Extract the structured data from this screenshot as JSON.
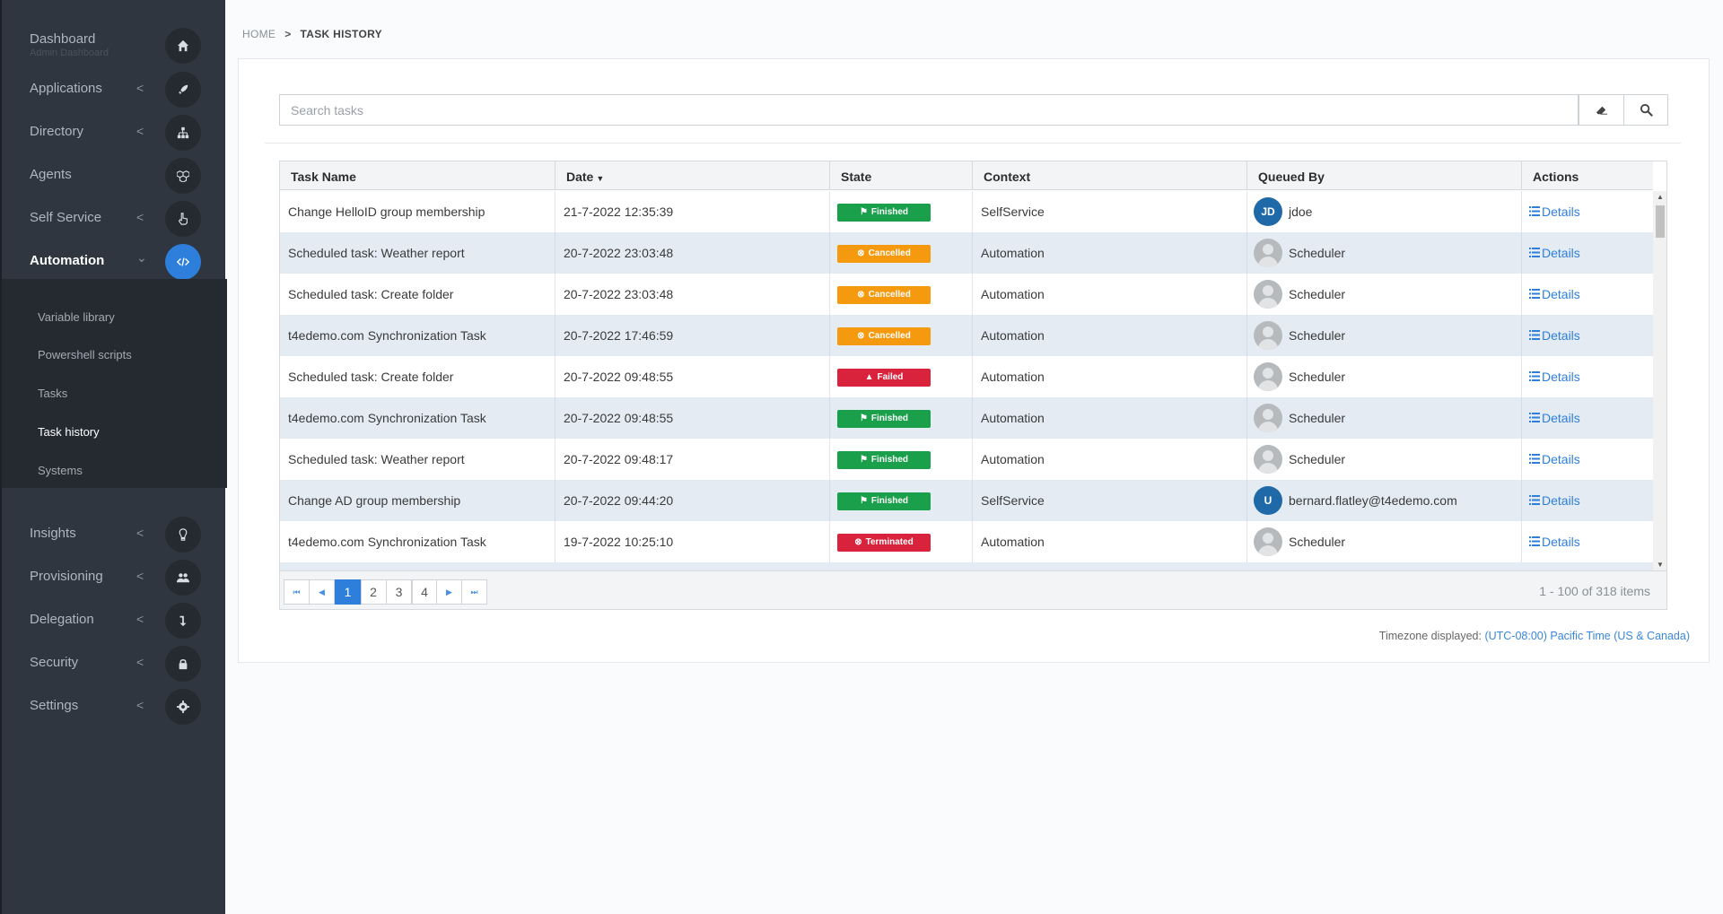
{
  "sidebar": {
    "dashboard": {
      "label": "Dashboard",
      "sub": "Admin Dashboard",
      "icon": "home-icon"
    },
    "items": [
      {
        "label": "Applications",
        "icon": "rocket-icon",
        "chevron": "<"
      },
      {
        "label": "Directory",
        "icon": "sitemap-icon",
        "chevron": "<"
      },
      {
        "label": "Agents",
        "icon": "cubes-icon",
        "chevron": ""
      },
      {
        "label": "Self Service",
        "icon": "hand-pointer-icon",
        "chevron": "<"
      },
      {
        "label": "Automation",
        "icon": "code-icon",
        "chevron": "⌄",
        "active": true
      },
      {
        "label": "Insights",
        "icon": "lightbulb-icon",
        "chevron": "<"
      },
      {
        "label": "Provisioning",
        "icon": "users-icon",
        "chevron": "<"
      },
      {
        "label": "Delegation",
        "icon": "level-down-icon",
        "chevron": "<"
      },
      {
        "label": "Security",
        "icon": "lock-icon",
        "chevron": "<"
      },
      {
        "label": "Settings",
        "icon": "gear-icon",
        "chevron": "<"
      }
    ],
    "submenu": [
      {
        "label": "Variable library"
      },
      {
        "label": "Powershell scripts"
      },
      {
        "label": "Tasks"
      },
      {
        "label": "Task history",
        "active": true
      },
      {
        "label": "Systems"
      }
    ]
  },
  "breadcrumb": {
    "home": "HOME",
    "separator": ">",
    "current": "TASK HISTORY"
  },
  "search": {
    "placeholder": "Search tasks",
    "value": ""
  },
  "table": {
    "columns": [
      "Task Name",
      "Date",
      "State",
      "Context",
      "Queued By",
      "Actions"
    ],
    "sort_indicator": "▼",
    "details_label": "Details",
    "rows": [
      {
        "task": "Change HelloID group membership",
        "date": "21-7-2022 12:35:39",
        "state": "Finished",
        "context": "SelfService",
        "queued_by": "jdoe",
        "avatar": "JD"
      },
      {
        "task": "Scheduled task: Weather report",
        "date": "20-7-2022 23:03:48",
        "state": "Cancelled",
        "context": "Automation",
        "queued_by": "Scheduler",
        "avatar": ""
      },
      {
        "task": "Scheduled task: Create folder",
        "date": "20-7-2022 23:03:48",
        "state": "Cancelled",
        "context": "Automation",
        "queued_by": "Scheduler",
        "avatar": ""
      },
      {
        "task": "t4edemo.com Synchronization Task",
        "date": "20-7-2022 17:46:59",
        "state": "Cancelled",
        "context": "Automation",
        "queued_by": "Scheduler",
        "avatar": ""
      },
      {
        "task": "Scheduled task: Create folder",
        "date": "20-7-2022 09:48:55",
        "state": "Failed",
        "context": "Automation",
        "queued_by": "Scheduler",
        "avatar": ""
      },
      {
        "task": "t4edemo.com Synchronization Task",
        "date": "20-7-2022 09:48:55",
        "state": "Finished",
        "context": "Automation",
        "queued_by": "Scheduler",
        "avatar": ""
      },
      {
        "task": "Scheduled task: Weather report",
        "date": "20-7-2022 09:48:17",
        "state": "Finished",
        "context": "Automation",
        "queued_by": "Scheduler",
        "avatar": ""
      },
      {
        "task": "Change AD group membership",
        "date": "20-7-2022 09:44:20",
        "state": "Finished",
        "context": "SelfService",
        "queued_by": "bernard.flatley@t4edemo.com",
        "avatar": "U"
      },
      {
        "task": "t4edemo.com Synchronization Task",
        "date": "19-7-2022 10:25:10",
        "state": "Terminated",
        "context": "Automation",
        "queued_by": "Scheduler",
        "avatar": ""
      }
    ],
    "state_styles": {
      "Finished": {
        "color": "#1aa04a",
        "icon": "flag-icon",
        "glyph": "⚑"
      },
      "Cancelled": {
        "color": "#f5990f",
        "icon": "circle-x-icon",
        "glyph": "⊗"
      },
      "Failed": {
        "color": "#d9233c",
        "icon": "warning-icon",
        "glyph": "▲"
      },
      "Terminated": {
        "color": "#d9233c",
        "icon": "circle-x-icon",
        "glyph": "⊗"
      }
    },
    "avatar_colors": {
      "JD": "#1f69a8",
      "U": "#1f69a8"
    }
  },
  "pagination": {
    "pages": [
      "1",
      "2",
      "3",
      "4"
    ],
    "current": "1",
    "info": "1 - 100 of 318 items"
  },
  "timezone": {
    "label": "Timezone displayed:",
    "value": "(UTC-08:00) Pacific Time (US & Canada)"
  }
}
